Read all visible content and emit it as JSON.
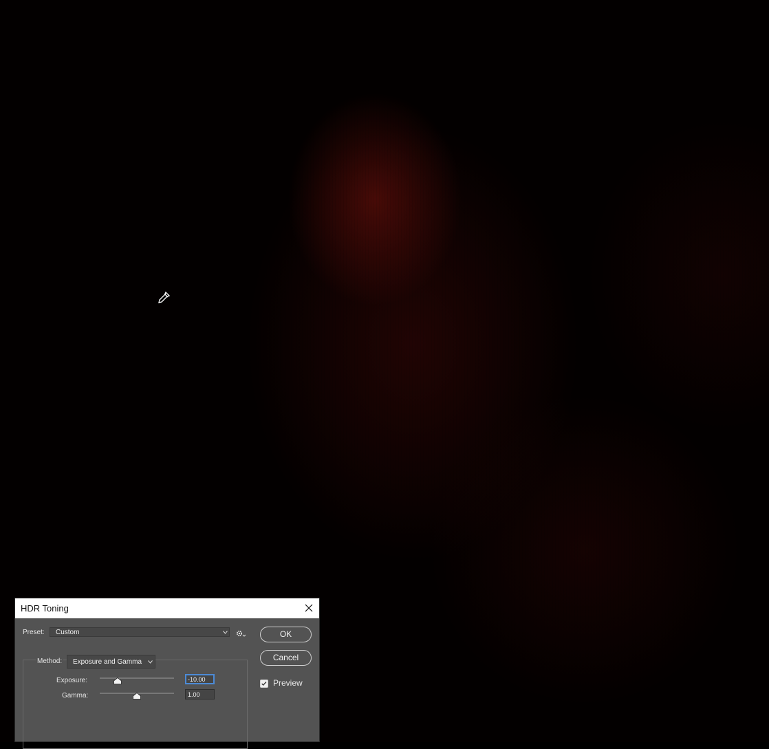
{
  "canvas": {
    "cursor_icon": "eyedropper-icon"
  },
  "dialog": {
    "title": "HDR Toning",
    "close_icon": "close-icon",
    "preset": {
      "label": "Preset:",
      "value": "Custom",
      "options_icon": "gear-icon"
    },
    "method": {
      "label": "Method:",
      "value": "Exposure and Gamma"
    },
    "exposure": {
      "label": "Exposure:",
      "value": "-10.00",
      "slider_fraction": 0.24
    },
    "gamma": {
      "label": "Gamma:",
      "value": "1.00",
      "slider_fraction": 0.5
    },
    "ok_label": "OK",
    "cancel_label": "Cancel",
    "preview": {
      "label": "Preview",
      "checked": true
    }
  },
  "colors": {
    "dialog_bg": "#535353",
    "focus_accent": "#4c8bd6",
    "image_tint": "#7a120c"
  }
}
